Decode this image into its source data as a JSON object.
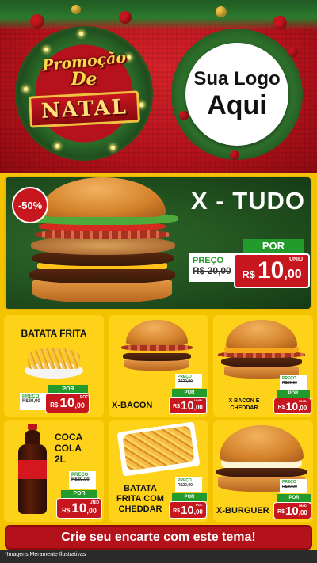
{
  "header": {
    "promo_line1": "Promoção",
    "promo_line2": "De",
    "promo_line3": "NATAL",
    "logo_line1": "Sua Logo",
    "logo_line2": "Aqui"
  },
  "hero": {
    "discount": "-50%",
    "title": "X - TUDO",
    "por": "POR",
    "preco": "PREÇO",
    "old_price": "R$ 20,00",
    "currency": "R$",
    "price_int": "10",
    "price_dec": ",00",
    "unit": "UNID"
  },
  "products": [
    {
      "name": "BATATA FRITA",
      "preco": "PREÇO",
      "old_price": "R$20,00",
      "por": "POR",
      "currency": "R$",
      "price_int": "10",
      "price_dec": ",00",
      "unit": "POC"
    },
    {
      "name": "X-BACON",
      "preco": "PREÇO",
      "old_price": "R$20,00",
      "por": "POR",
      "currency": "R$",
      "price_int": "10",
      "price_dec": ",00",
      "unit": "UNID"
    },
    {
      "name": "X BACON E CHEDDAR",
      "preco": "PREÇO",
      "old_price": "R$20,00",
      "por": "POR",
      "currency": "R$",
      "price_int": "10",
      "price_dec": ",00",
      "unit": "UNID"
    },
    {
      "name_l1": "COCA",
      "name_l2": "COLA",
      "name_l3": "2L",
      "preco": "PREÇO",
      "old_price": "R$20,00",
      "por": "POR",
      "currency": "R$",
      "price_int": "10",
      "price_dec": ",00",
      "unit": "UNID"
    },
    {
      "name": "BATATA FRITA COM CHEDDAR",
      "preco": "PREÇO",
      "old_price": "R$20,00",
      "por": "POR",
      "currency": "R$",
      "price_int": "10",
      "price_dec": ",00",
      "unit": "POC"
    },
    {
      "name": "X-BURGUER",
      "preco": "PREÇO",
      "old_price": "R$20,00",
      "por": "POR",
      "currency": "R$",
      "price_int": "10",
      "price_dec": ",00",
      "unit": "UNID"
    }
  ],
  "cta": "Crie seu encarte com este tema!",
  "disclaimer": "*Imagens Meramente Ilustrativas",
  "colors": {
    "red": "#c8161f",
    "green": "#239b2c",
    "yellow": "#ffd21a",
    "dark_green": "#1e4a1c"
  }
}
